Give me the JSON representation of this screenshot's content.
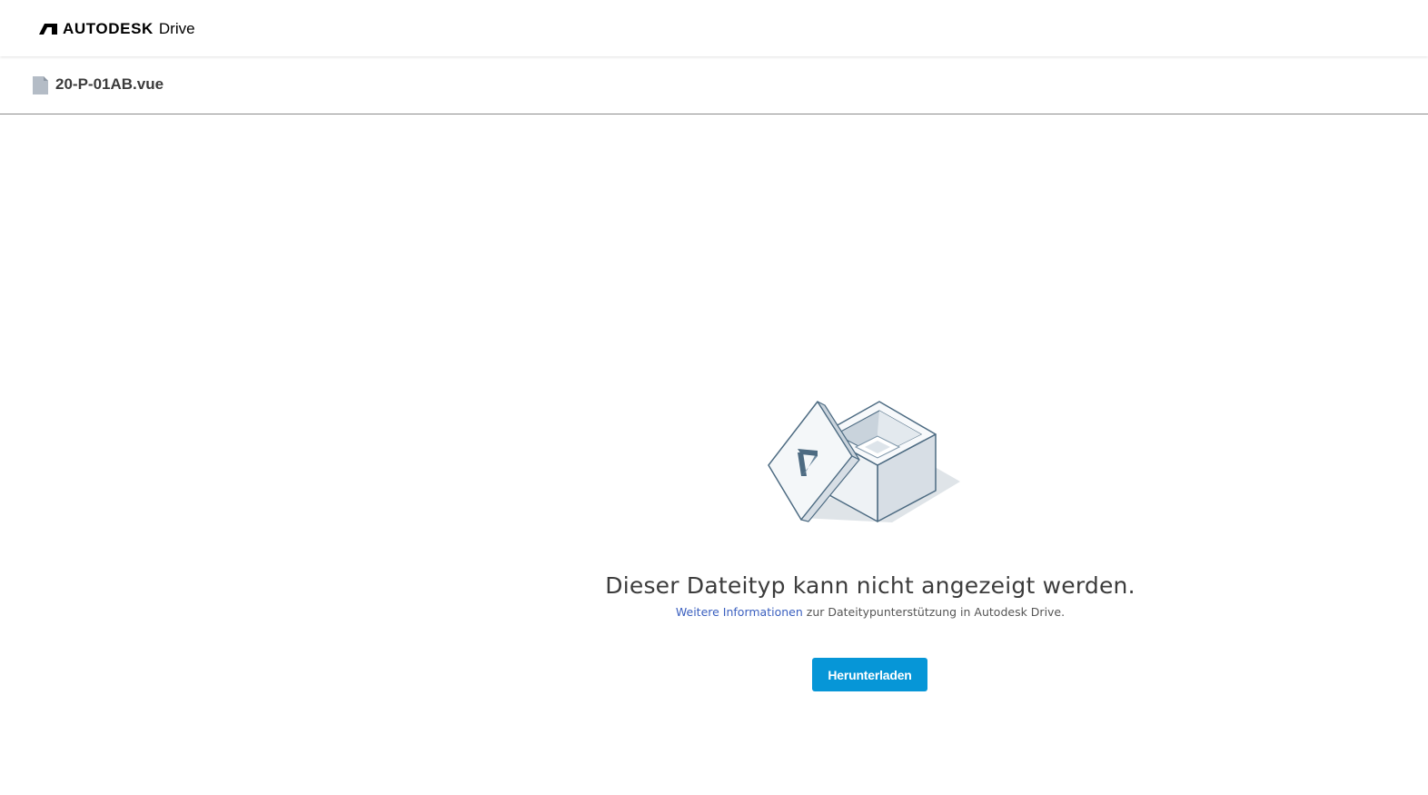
{
  "header": {
    "brand_name": "AUTODESK",
    "product_name": "Drive",
    "logo_icon": "autodesk-logo-icon"
  },
  "file": {
    "icon": "file-icon",
    "name": "20-P-01AB.vue"
  },
  "message": {
    "illustration": "open-box-illustration",
    "title": "Dieser Dateityp kann nicht angezeigt werden.",
    "link_text": "Weitere Informationen",
    "sub_text": " zur Dateitypunterstützung in Autodesk Drive."
  },
  "actions": {
    "download_label": "Herunterladen"
  },
  "colors": {
    "accent": "#0696d7",
    "link": "#3a5fbf",
    "text": "#3c3c3c"
  }
}
